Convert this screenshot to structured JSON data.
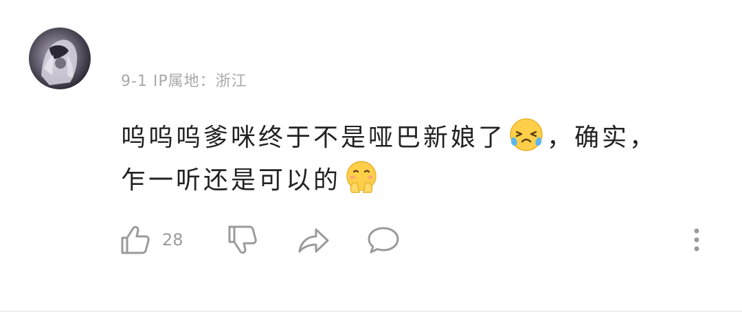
{
  "comment": {
    "meta": "9-1 IP属地：浙江",
    "text_part1": "呜呜呜爹咪终于不是哑巴新娘了",
    "text_part2": "，确实，乍一听还是可以的"
  },
  "actions": {
    "like_count": "28"
  },
  "icons": {
    "avatar": "avatar",
    "emoji1": "crying-laughing-emoji",
    "emoji2": "blushing-hands-emoji",
    "like": "thumbs-up-icon",
    "dislike": "thumbs-down-icon",
    "share": "share-arrow-icon",
    "reply": "comment-bubble-icon",
    "more": "more-dots-icon"
  },
  "colors": {
    "icon_gray": "#9a9a9a",
    "meta_gray": "#a8a8a8",
    "text": "#222222",
    "emoji_yellow": "#ffcf4a"
  }
}
